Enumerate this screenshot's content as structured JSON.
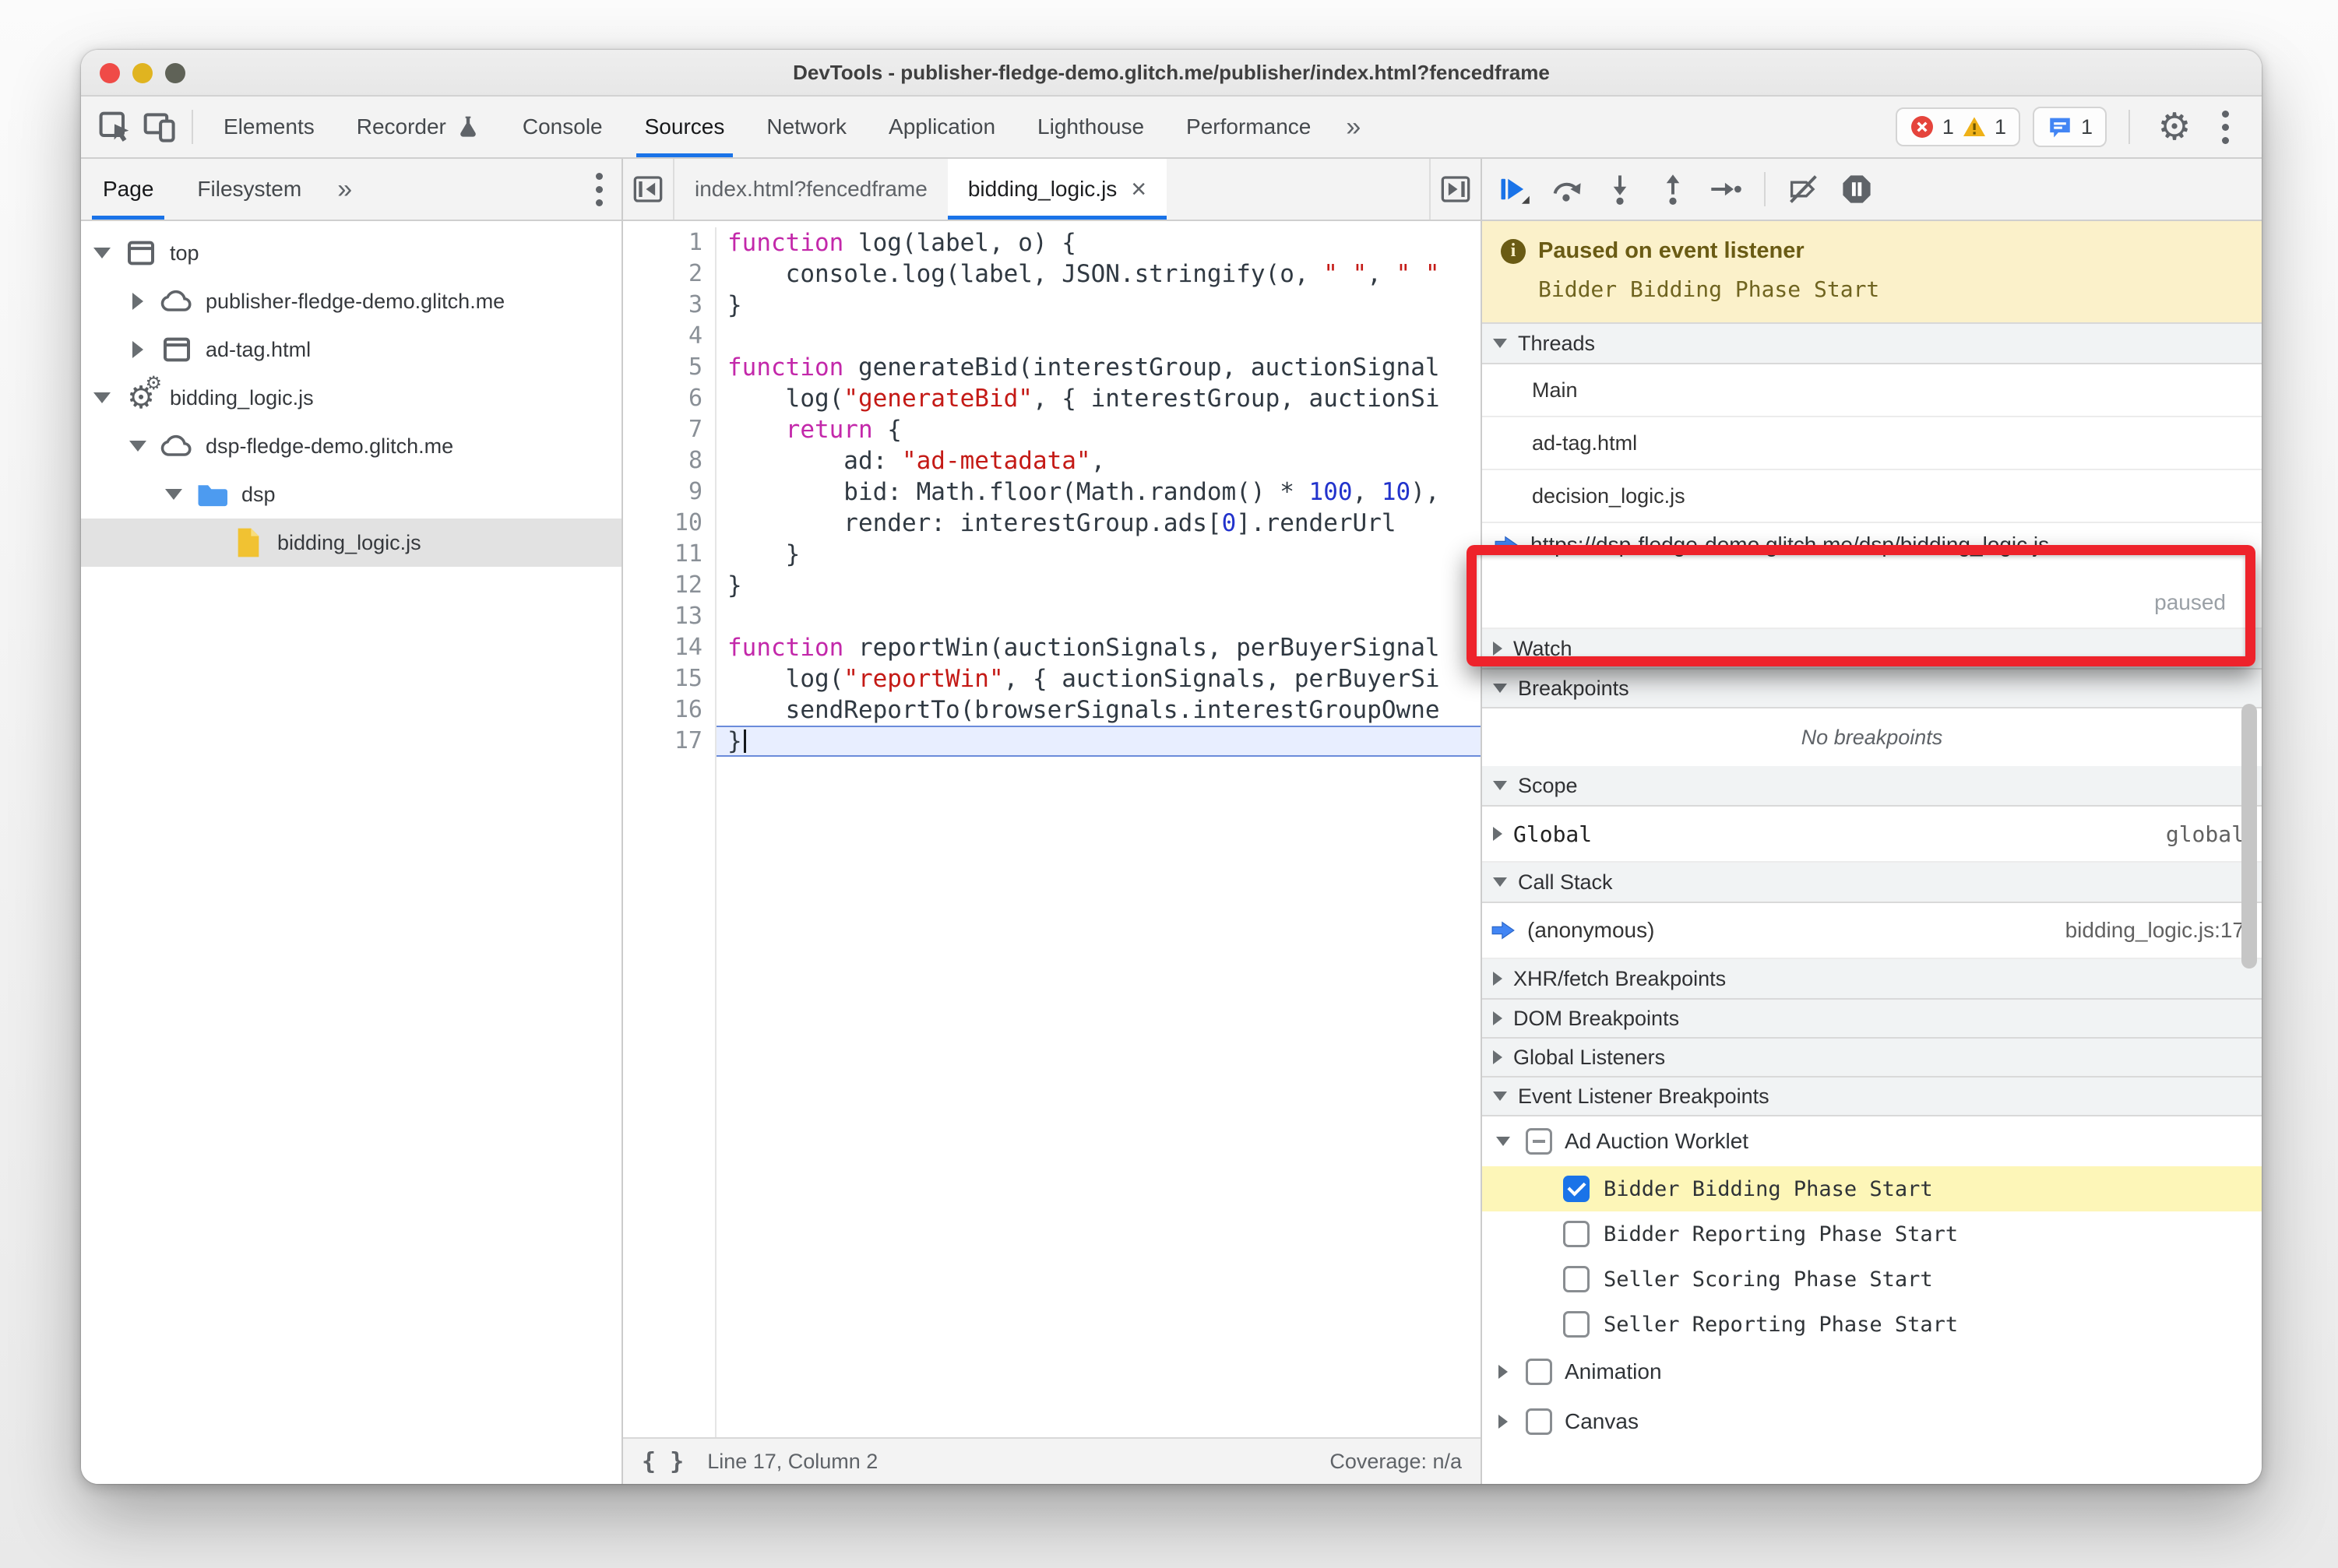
{
  "window": {
    "title": "DevTools - publisher-fledge-demo.glitch.me/publisher/index.html?fencedframe"
  },
  "toolbar": {
    "tabs": [
      {
        "label": "Elements"
      },
      {
        "label": "Recorder",
        "icon": "flask"
      },
      {
        "label": "Console"
      },
      {
        "label": "Sources",
        "active": true
      },
      {
        "label": "Network"
      },
      {
        "label": "Application"
      },
      {
        "label": "Lighthouse"
      },
      {
        "label": "Performance"
      }
    ],
    "more_tabs_chevron": "»",
    "badges": {
      "errors": "1",
      "warnings": "1",
      "issues": "1"
    }
  },
  "sidebar": {
    "tabs": [
      "Page",
      "Filesystem"
    ],
    "more_chevron": "»",
    "tree": [
      {
        "label": "top",
        "icon": "frame",
        "expander": "open",
        "depth": 0
      },
      {
        "label": "publisher-fledge-demo.glitch.me",
        "icon": "cloud",
        "expander": "closed",
        "depth": 1
      },
      {
        "label": "ad-tag.html",
        "icon": "frame",
        "expander": "closed",
        "depth": 1
      },
      {
        "label": "bidding_logic.js",
        "icon": "worker",
        "expander": "open",
        "depth": 0
      },
      {
        "label": "dsp-fledge-demo.glitch.me",
        "icon": "cloud",
        "expander": "open",
        "depth": 1
      },
      {
        "label": "dsp",
        "icon": "folder",
        "expander": "open",
        "depth": 2
      },
      {
        "label": "bidding_logic.js",
        "icon": "file",
        "expander": "none",
        "depth": 3,
        "selected": true
      }
    ]
  },
  "editor": {
    "tabs": [
      {
        "label": "index.html?fencedframe"
      },
      {
        "label": "bidding_logic.js",
        "active": true,
        "close": "×"
      }
    ],
    "code": {
      "active_line": 17,
      "lines": [
        "function log(label, o) {",
        "    console.log(label, JSON.stringify(o, \" \", \" \"",
        "}",
        "",
        "function generateBid(interestGroup, auctionSignal",
        "    log(\"generateBid\", { interestGroup, auctionSi",
        "    return {",
        "        ad: \"ad-metadata\",",
        "        bid: Math.floor(Math.random() * 100, 10),",
        "        render: interestGroup.ads[0].renderUrl",
        "    }",
        "}",
        "",
        "function reportWin(auctionSignals, perBuyerSignal",
        "    log(\"reportWin\", { auctionSignals, perBuyerSi",
        "    sendReportTo(browserSignals.interestGroupOwne",
        "}"
      ]
    },
    "status": {
      "pretty_print": "{ }",
      "position": "Line 17, Column 2",
      "coverage": "Coverage: n/a"
    }
  },
  "debugger": {
    "paused": {
      "title": "Paused on event listener",
      "detail": "Bidder Bidding Phase Start"
    },
    "threads": {
      "label": "Threads",
      "items": [
        "Main",
        "ad-tag.html",
        "decision_logic.js"
      ],
      "active": {
        "url": "https://dsp-fledge-demo.glitch.me/dsp/bidding_logic.js",
        "status": "paused"
      }
    },
    "watch": {
      "label": "Watch"
    },
    "breakpoints": {
      "label": "Breakpoints",
      "empty_text": "No breakpoints"
    },
    "scope": {
      "label": "Scope",
      "name": "Global",
      "type": "global"
    },
    "call_stack": {
      "label": "Call Stack",
      "frame": "(anonymous)",
      "location": "bidding_logic.js:17"
    },
    "xhr": {
      "label": "XHR/fetch Breakpoints"
    },
    "dom": {
      "label": "DOM Breakpoints"
    },
    "global_listeners": {
      "label": "Global Listeners"
    },
    "event_listener_breakpoints": {
      "label": "Event Listener Breakpoints",
      "categories": [
        {
          "label": "Ad Auction Worklet",
          "state": "indeterminate",
          "expanded": true,
          "children": [
            {
              "label": "Bidder Bidding Phase Start",
              "state": "checked",
              "highlighted": true
            },
            {
              "label": "Bidder Reporting Phase Start",
              "state": "unchecked"
            },
            {
              "label": "Seller Scoring Phase Start",
              "state": "unchecked"
            },
            {
              "label": "Seller Reporting Phase Start",
              "state": "unchecked"
            }
          ]
        },
        {
          "label": "Animation",
          "state": "unchecked",
          "expanded": false
        },
        {
          "label": "Canvas",
          "state": "unchecked",
          "expanded": false
        }
      ]
    }
  },
  "colors": {
    "accent_blue": "#1a73e8",
    "annotation_red": "#ee232b",
    "paused_banner_bg": "#fbf1ca",
    "breakpoint_highlight": "#fdf6b8",
    "keyword": "#c328aa",
    "string": "#c41a16",
    "number": "#2233cc",
    "code_text": "#303942"
  }
}
